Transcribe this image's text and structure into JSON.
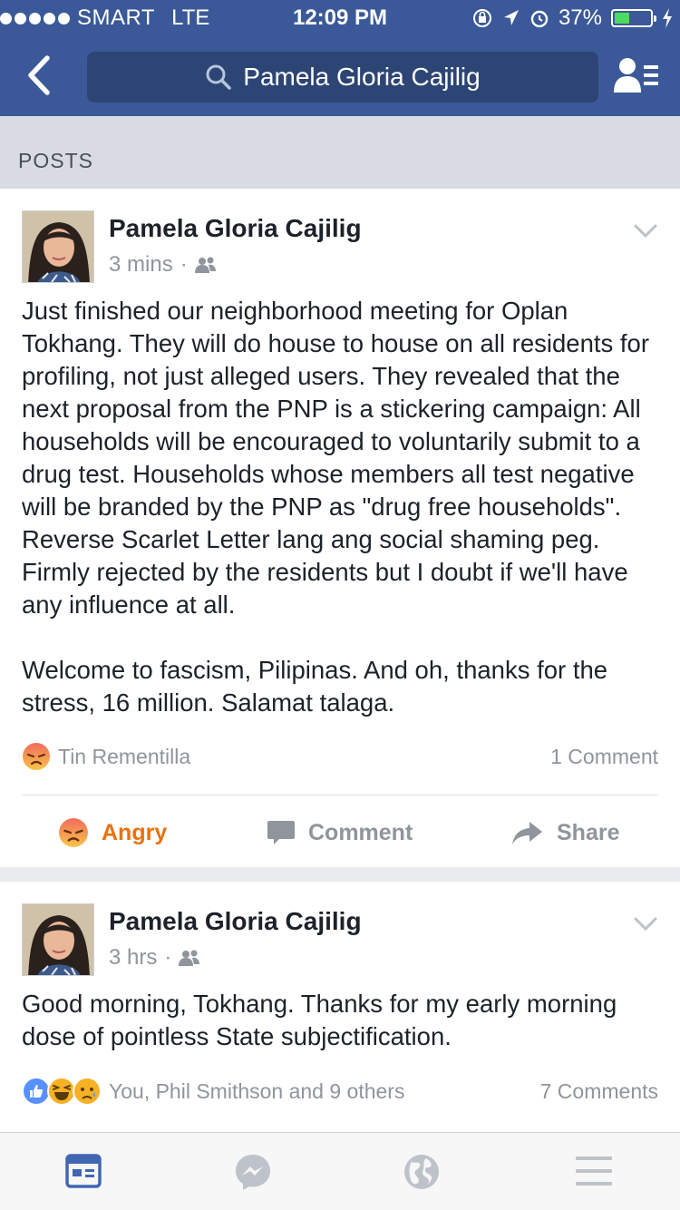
{
  "status_bar": {
    "carrier": "SMART",
    "network": "LTE",
    "time": "12:09 PM",
    "battery": "37%"
  },
  "nav": {
    "search_query": "Pamela Gloria Cajilig",
    "back_icon": "chevron-left-icon",
    "profile_icon": "friend-list-icon"
  },
  "section": {
    "title": "POSTS"
  },
  "posts": [
    {
      "author": "Pamela Gloria Cajilig",
      "time": "3 mins",
      "audience_icon": "friends-icon",
      "text": "Just finished our neighborhood meeting for Oplan Tokhang. They will do house to house on all residents for profiling, not just alleged users. They revealed that the next proposal from the PNP is a stickering campaign: All households will be encouraged to voluntarily submit to a drug test. Households whose members all test negative will be branded by the PNP as \"drug free households\". Reverse Scarlet Letter lang ang social shaming peg. Firmly rejected by the residents but I doubt if we'll have any influence at all.\n\nWelcome to fascism, Pilipinas. And oh, thanks for the stress, 16 million. Salamat talaga.",
      "reactions_text": "Tin Rementilla",
      "comments_text": "1 Comment",
      "actions": {
        "react": "Angry",
        "comment": "Comment",
        "share": "Share"
      }
    },
    {
      "author": "Pamela Gloria Cajilig",
      "time": "3 hrs",
      "audience_icon": "friends-icon",
      "text": "Good morning, Tokhang. Thanks for my early morning dose of pointless State subjectification.",
      "reactions_text": "You, Phil Smithson and 9 others",
      "comments_text": "7 Comments"
    }
  ],
  "tabbar": [
    "news-feed-icon",
    "messenger-icon",
    "globe-icon",
    "menu-icon"
  ],
  "colors": {
    "brand": "#3b5998",
    "angry": "#e9710f",
    "muted": "#90949c",
    "text": "#1d2129"
  }
}
